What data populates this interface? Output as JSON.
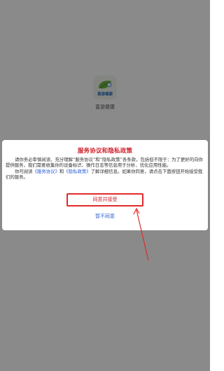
{
  "app": {
    "name": "喜游健康",
    "logo_text": "喜游健康",
    "logo_icon": "leaf-logo-icon"
  },
  "dialog": {
    "title": "服务协议和隐私政策",
    "paragraph1": "请你务必审慎阅读、充分理解“服务协议”和“隐私政策”各条款，包括但不限于：为了更好的向你提供服务，我们需要收集你的设备标识、操作日志等信息用于分析、优化应用性能。",
    "p2_prefix": "你可阅读",
    "service_link": "《服务协议》",
    "p2_and": "和",
    "privacy_link": "《隐私政策》",
    "p2_suffix": "了解详细信息。如果你同意，请点击下面按钮开始接受我们的服务。",
    "agree_label": "同意并接受",
    "disagree_label": "暂不同意"
  },
  "colors": {
    "accent_red": "#d0202c",
    "link_blue": "#2a5bd7",
    "annotation_red": "#e02b2b"
  }
}
